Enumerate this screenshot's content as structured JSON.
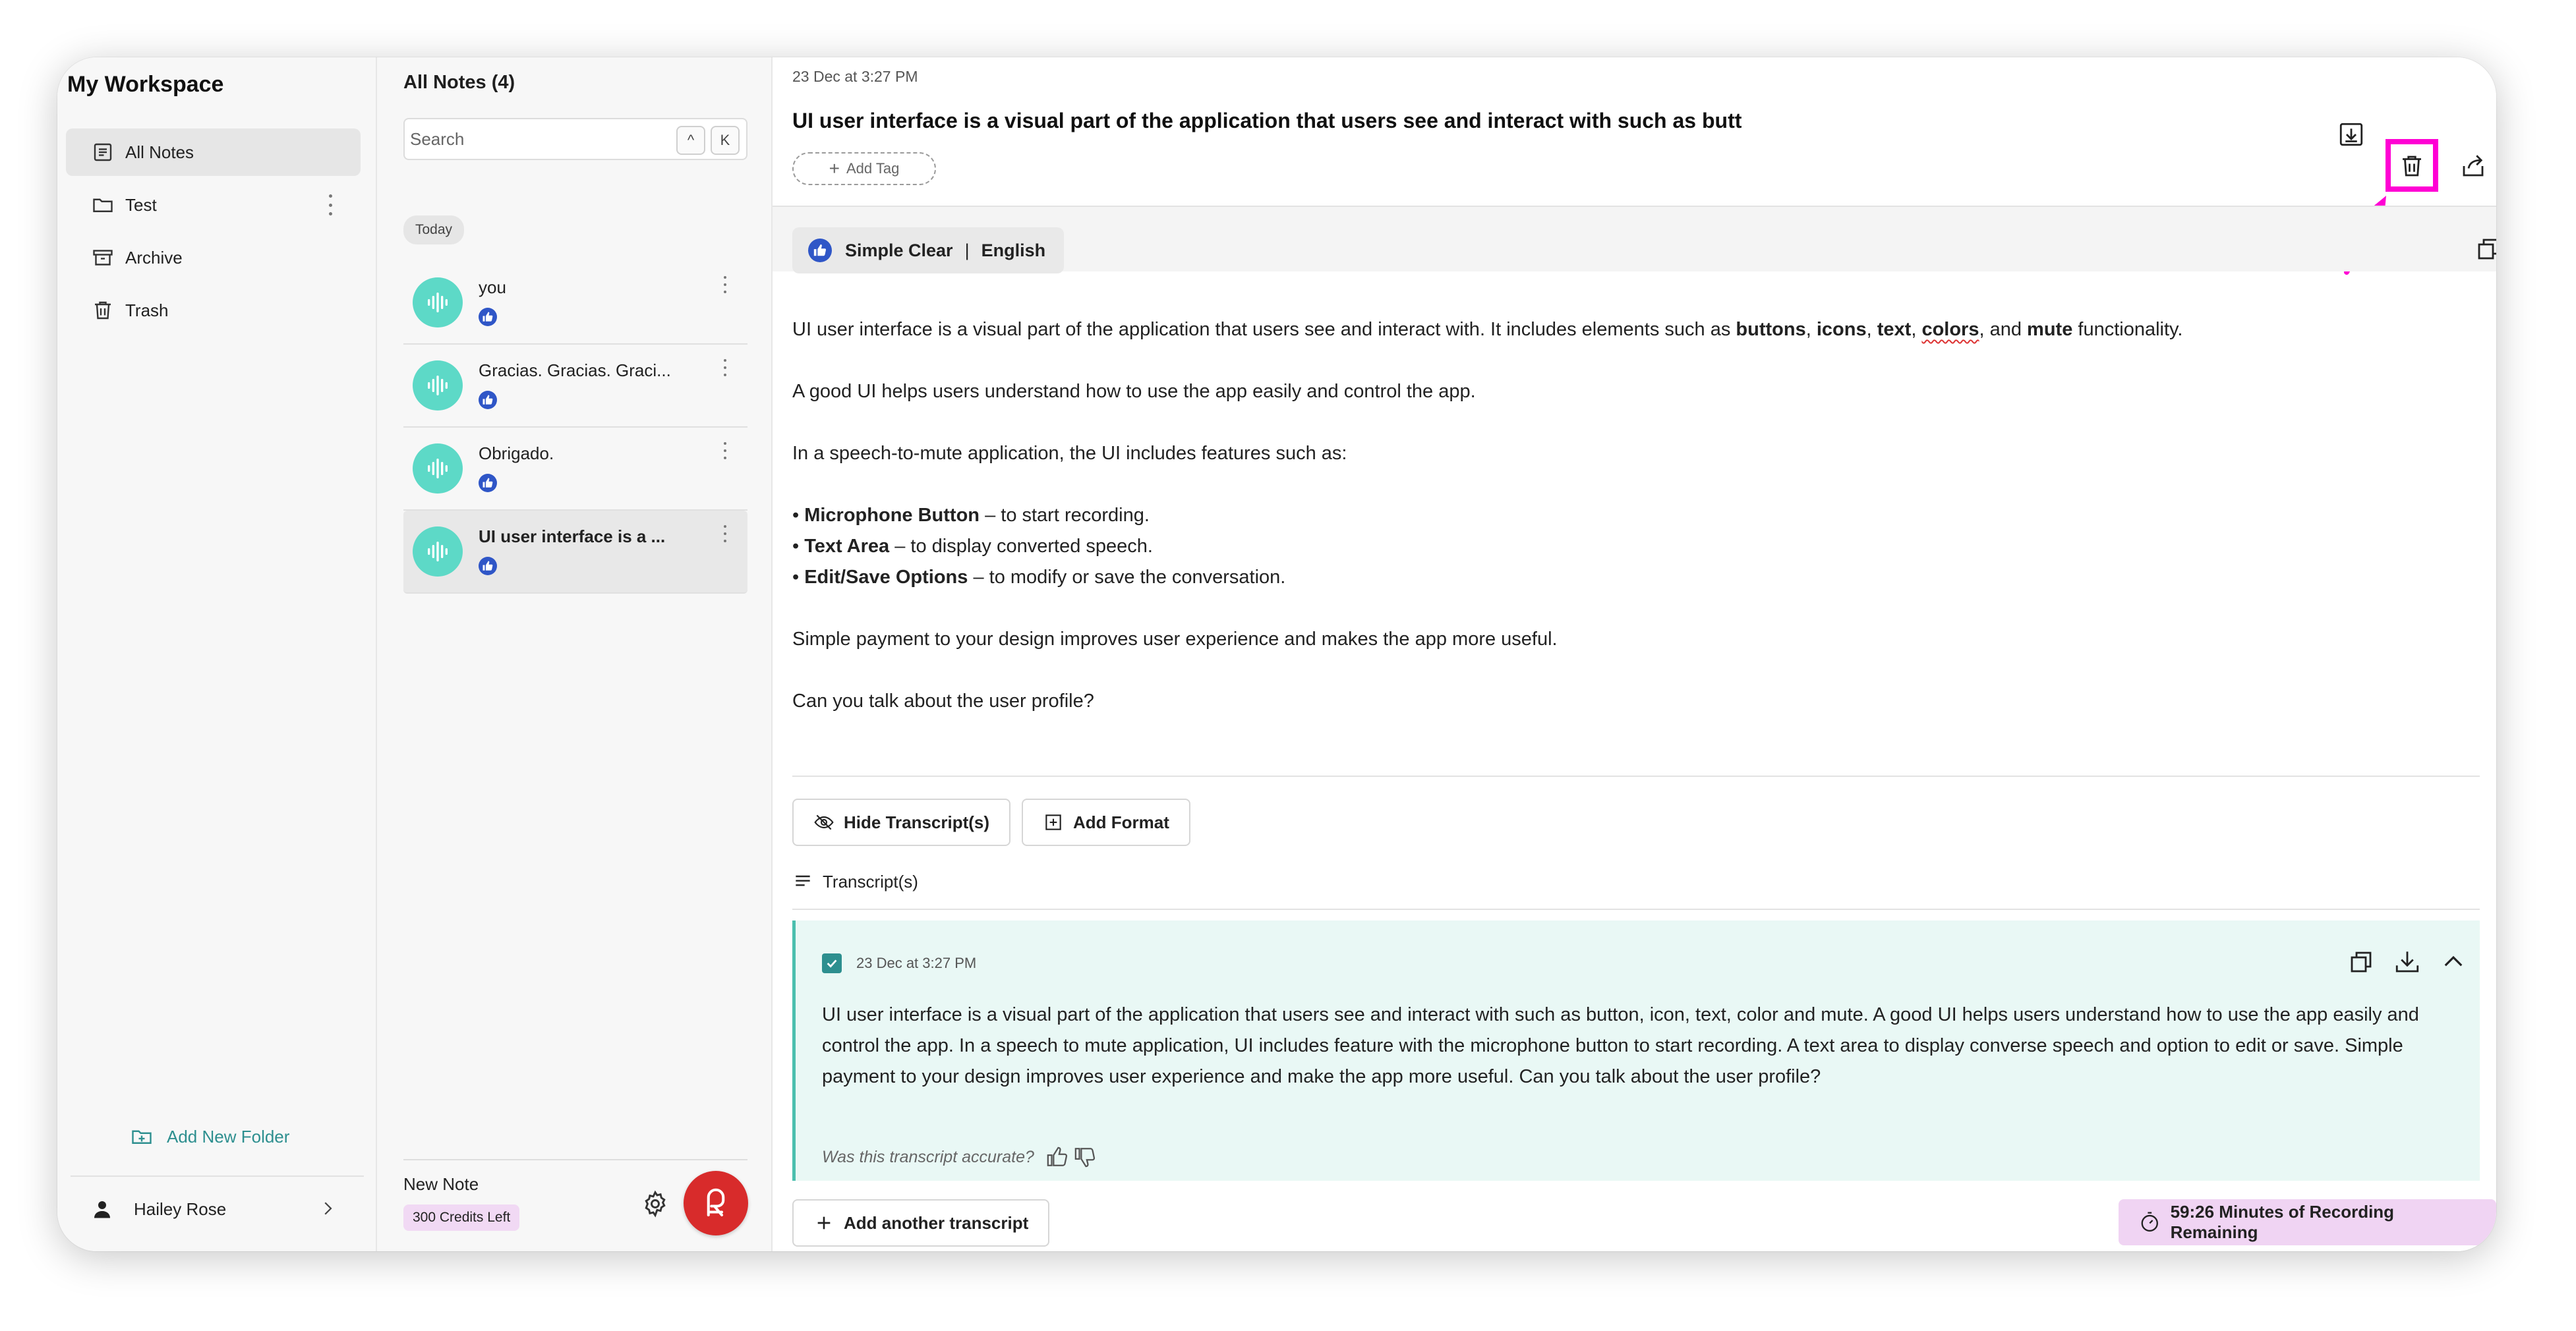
{
  "sidebar": {
    "workspace_title": "My Workspace",
    "items": [
      {
        "label": "All Notes",
        "icon": "notes-icon"
      },
      {
        "label": "Test",
        "icon": "folder-icon"
      },
      {
        "label": "Archive",
        "icon": "archive-icon"
      },
      {
        "label": "Trash",
        "icon": "trash-icon"
      }
    ],
    "add_folder_label": "Add New Folder",
    "user_name": "Hailey Rose"
  },
  "notes_panel": {
    "title": "All Notes (4)",
    "search_placeholder": "Search",
    "shortcut_keys": [
      "^",
      "K"
    ],
    "group_label": "Today",
    "notes": [
      {
        "title": "you"
      },
      {
        "title": "Gracias. Gracias. Graci..."
      },
      {
        "title": "Obrigado."
      },
      {
        "title": "UI user interface is a ..."
      }
    ],
    "new_note_label": "New Note",
    "credits_label": "300 Credits Left"
  },
  "note": {
    "date": "23 Dec at 3:27 PM",
    "title": "UI user interface is a visual part of the application that users see and interact with such as butt",
    "add_tag_label": "Add Tag",
    "format_style": "Simple Clear",
    "format_separator": "|",
    "format_language": "English",
    "summary": {
      "p1_prefix": "UI user interface is a visual part of the application that users see and interact with. It includes elements such as ",
      "p1_b1": "buttons",
      "p1_s1": ", ",
      "p1_b2": "icons",
      "p1_s2": ", ",
      "p1_b3": "text",
      "p1_s3": ", ",
      "p1_b4": "colors",
      "p1_s4": ", and ",
      "p1_b5": "mute",
      "p1_suffix": " functionality.",
      "p2": "A good UI helps users understand how to use the app easily and control the app.",
      "p3": "In a speech-to-mute application, the UI includes features such as:",
      "bullets": [
        {
          "bold": "Microphone Button",
          "rest": " – to start recording."
        },
        {
          "bold": "Text Area",
          "rest": " – to display converted speech."
        },
        {
          "bold": "Edit/Save Options",
          "rest": " – to modify or save the conversation."
        }
      ],
      "bullet_mark": "•",
      "p4": "Simple payment to your design improves user experience and makes the app more useful.",
      "p5": "Can you talk about the user profile?"
    },
    "hide_transcripts_label": "Hide Transcript(s)",
    "add_format_label": "Add Format",
    "transcripts_label": "Transcript(s)",
    "transcript": {
      "date": "23 Dec at 3:27 PM",
      "text": "UI user interface is a visual part of the application that users see and interact with such as button, icon, text, color and mute. A good UI helps users understand how to use the app easily and control the app. In a speech to mute application, UI includes feature with the microphone button to start recording. A text area to display converse speech and option to edit or save. Simple payment to your design improves user experience and make the app more useful. Can you talk about the user profile?",
      "feedback_prompt": "Was this transcript accurate?"
    },
    "add_transcript_label": "Add another transcript",
    "recording_remaining": "59:26 Minutes of Recording Remaining"
  },
  "colors": {
    "accent_teal": "#2d8f8f",
    "wave_avatar": "#5dd9c7",
    "highlight": "#ff00d4",
    "record_red": "#d82b2b",
    "badge_blue": "#2f56c7",
    "credits_bg": "#f1d9f4"
  }
}
